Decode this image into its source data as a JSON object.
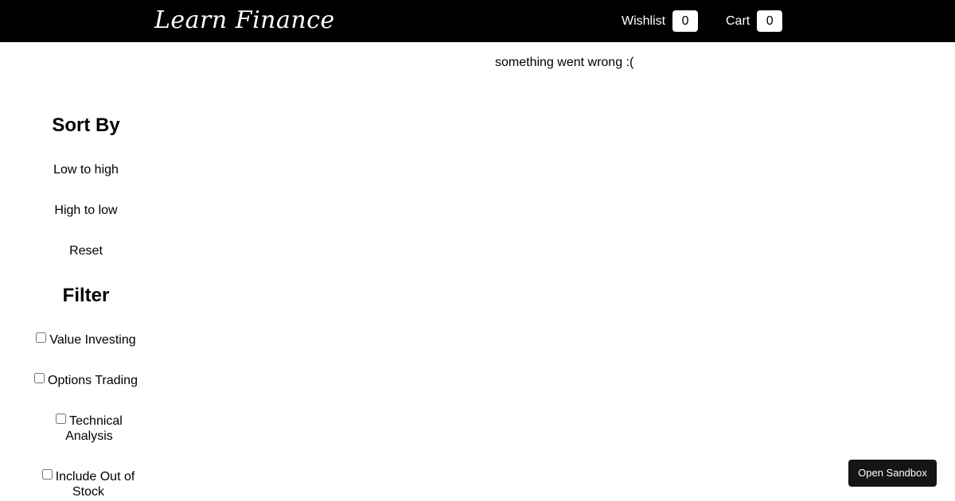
{
  "navbar": {
    "brand": "Learn Finance",
    "wishlist": {
      "label": "Wishlist",
      "count": "0"
    },
    "cart": {
      "label": "Cart",
      "count": "0"
    }
  },
  "main": {
    "error_message": "something went wrong :("
  },
  "sidebar": {
    "sort": {
      "title": "Sort By",
      "options": [
        "Low to high",
        "High to low",
        "Reset"
      ]
    },
    "filter": {
      "title": "Filter",
      "options": [
        {
          "label": "Value Investing",
          "checked": false
        },
        {
          "label": "Options Trading",
          "checked": false
        },
        {
          "label": "Technical Analysis",
          "checked": false
        },
        {
          "label": "Include Out of Stock",
          "checked": false
        }
      ]
    }
  },
  "sandbox_button": {
    "label": "Open Sandbox"
  }
}
